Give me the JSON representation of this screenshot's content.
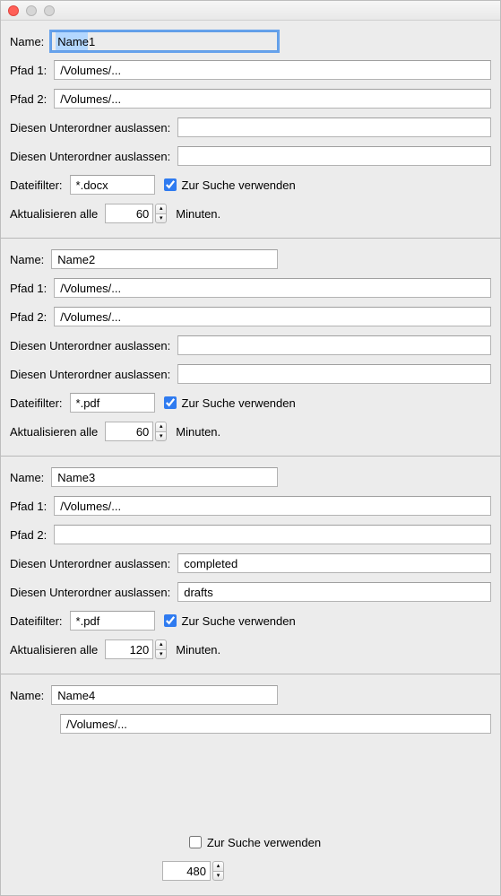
{
  "labels": {
    "name": "Name:",
    "pfad1": "Pfad 1:",
    "pfad2": "Pfad 2:",
    "skip_subfolder": "Diesen Unterordner auslassen:",
    "file_filter": "Dateifilter:",
    "use_for_search": "Zur Suche verwenden",
    "refresh_every": "Aktualisieren alle",
    "minutes": "Minuten."
  },
  "groups": [
    {
      "name": "Name1",
      "name_focused": true,
      "pfad1": "/Volumes/...",
      "pfad2": "/Volumes/...",
      "skip1": "",
      "skip2": "",
      "filter": "*.docx",
      "use_for_search": true,
      "refresh": "60"
    },
    {
      "name": "Name2",
      "name_focused": false,
      "pfad1": "/Volumes/...",
      "pfad2": "/Volumes/...",
      "skip1": "",
      "skip2": "",
      "filter": "*.pdf",
      "use_for_search": true,
      "refresh": "60"
    },
    {
      "name": "Name3",
      "name_focused": false,
      "pfad1": "/Volumes/...",
      "pfad2": "",
      "skip1": "completed",
      "skip2": "drafts",
      "filter": "*.pdf",
      "use_for_search": true,
      "refresh": "120"
    },
    {
      "name": "Name4",
      "name_focused": false,
      "pfad1": "/Volumes/...",
      "pfad2": null,
      "skip1": null,
      "skip2": null,
      "filter": null,
      "use_for_search": false,
      "refresh": "480",
      "minimal": true
    }
  ]
}
